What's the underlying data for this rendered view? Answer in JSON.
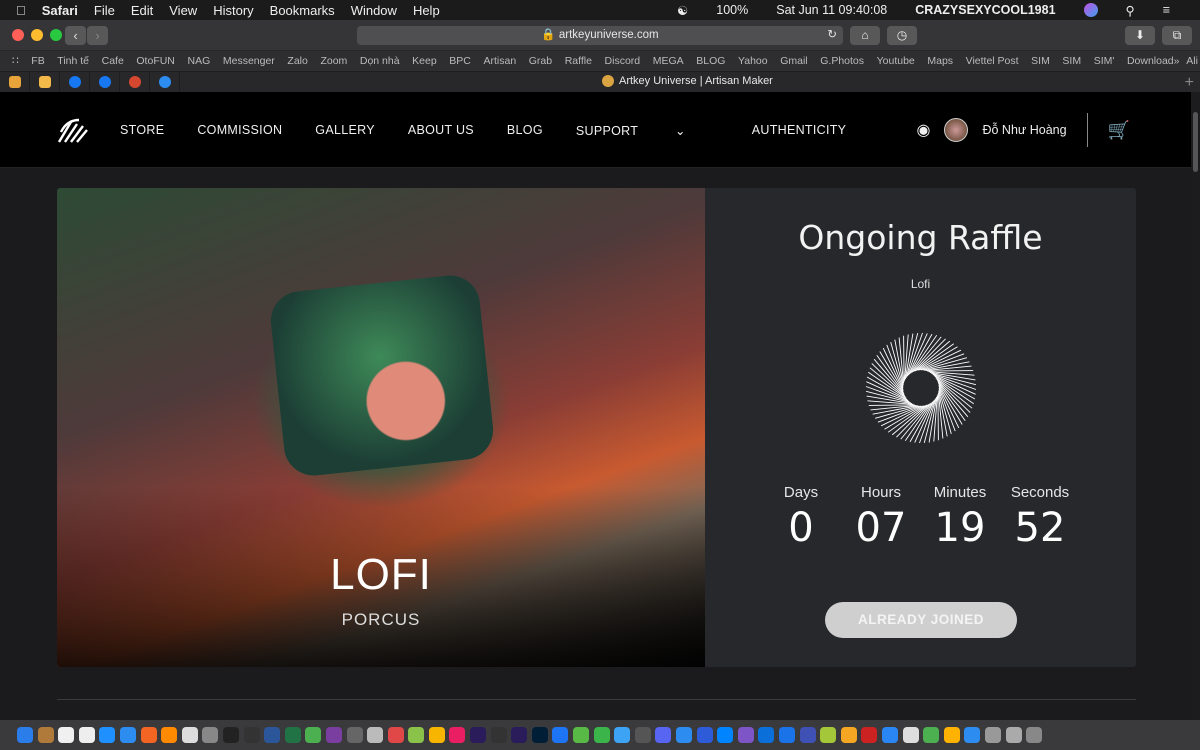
{
  "menubar": {
    "app": "Safari",
    "items": [
      "File",
      "Edit",
      "View",
      "History",
      "Bookmarks",
      "Window",
      "Help"
    ],
    "battery": "100%",
    "datetime": "Sat Jun 11  09:40:08",
    "user": "CRAZYSEXYCOOL1981"
  },
  "browser": {
    "url": "artkeyuniverse.com",
    "tab_title": "Artkey Universe | Artisan Maker",
    "bookmarks": [
      "FB",
      "Tinh tế",
      "Cafe",
      "OtoFUN",
      "NAG",
      "Messenger",
      "Zalo",
      "Zoom",
      "Dọn nhà",
      "Keep",
      "BPC",
      "Artisan",
      "Grab",
      "Raffle",
      "Discord",
      "MEGA",
      "BLOG",
      "Yahoo",
      "Gmail",
      "G.Photos",
      "Youtube",
      "Maps",
      "Viettel Post",
      "SIM",
      "SIM",
      "SIM'",
      "Download",
      "Ali"
    ],
    "favorites": [
      "#e8a33a",
      "#f2b84a",
      "#1877f2",
      "#1877f2",
      "#d5472f",
      "#2d8cf0"
    ]
  },
  "site": {
    "nav": [
      "STORE",
      "COMMISSION",
      "GALLERY",
      "ABOUT US",
      "BLOG",
      "SUPPORT",
      "AUTHENTICITY"
    ],
    "user_name": "Đỗ Như Hoàng"
  },
  "hero": {
    "title": "LOFI",
    "subtitle": "PORCUS"
  },
  "raffle": {
    "heading": "Ongoing Raffle",
    "product": "Lofi",
    "countdown": [
      {
        "label": "Days",
        "value": "0"
      },
      {
        "label": "Hours",
        "value": "07"
      },
      {
        "label": "Minutes",
        "value": "19"
      },
      {
        "label": "Seconds",
        "value": "52"
      }
    ],
    "button": "ALREADY JOINED"
  },
  "dock": {
    "icons": [
      "#2b7de9",
      "#b07a3a",
      "#f0f0f0",
      "#eee",
      "#1e90ff",
      "#2d8cf0",
      "#f26522",
      "#ff8a00",
      "#ddd",
      "#888",
      "#222",
      "#333",
      "#2b579a",
      "#217346",
      "#4caf50",
      "#7a3ea0",
      "#666",
      "#bbb",
      "#e04848",
      "#8bc34a",
      "#f7b500",
      "#e91e63",
      "#2a1c5a",
      "#333",
      "#2a1c5a",
      "#001e36",
      "#1d74f5",
      "#58b947",
      "#3bb54a",
      "#3da4f5",
      "#555",
      "#5865f2",
      "#2d8cf0",
      "#2e5bd8",
      "#0084ff",
      "#7d55c7",
      "#0a6fd8",
      "#1a73e8",
      "#3f51b5",
      "#a4c639",
      "#f5a623",
      "#c22",
      "#2a86f5",
      "#ddd",
      "#4caf50",
      "#ffb300",
      "#2d8cf0",
      "#999",
      "#aaa",
      "#888"
    ]
  }
}
